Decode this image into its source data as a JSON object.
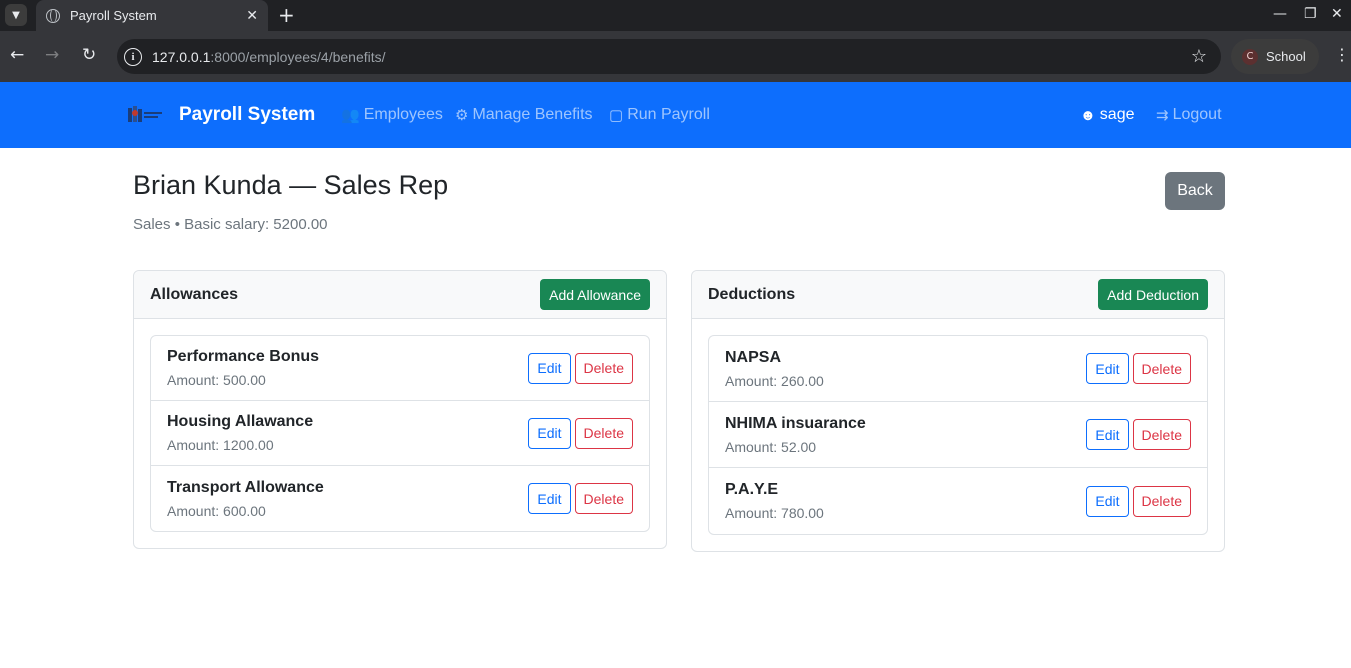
{
  "browser": {
    "tab_title": "Payroll System",
    "url_host": "127.0.0.1",
    "url_rest": ":8000/employees/4/benefits/",
    "profile_initial": "C",
    "profile_name": "School"
  },
  "navbar": {
    "brand": "Payroll System",
    "links": [
      {
        "label": "Employees",
        "icon": "users-icon"
      },
      {
        "label": "Manage Benefits",
        "icon": "gear-icon"
      },
      {
        "label": "Run Payroll",
        "icon": "money-icon"
      }
    ],
    "user": "sage",
    "logout": "Logout"
  },
  "page": {
    "title": "Brian Kunda — Sales Rep",
    "subtitle": "Sales • Basic salary: 5200.00",
    "back_label": "Back"
  },
  "allowances": {
    "title": "Allowances",
    "add_label": "Add Allowance",
    "items": [
      {
        "name": "Performance Bonus",
        "amount": "Amount: 500.00"
      },
      {
        "name": "Housing Allawance",
        "amount": "Amount: 1200.00"
      },
      {
        "name": "Transport Allowance",
        "amount": "Amount: 600.00"
      }
    ]
  },
  "deductions": {
    "title": "Deductions",
    "add_label": "Add Deduction",
    "items": [
      {
        "name": "NAPSA",
        "amount": "Amount: 260.00"
      },
      {
        "name": "NHIMA insuarance",
        "amount": "Amount: 52.00"
      },
      {
        "name": "P.A.Y.E",
        "amount": "Amount: 780.00"
      }
    ]
  },
  "actions": {
    "edit": "Edit",
    "delete": "Delete"
  }
}
